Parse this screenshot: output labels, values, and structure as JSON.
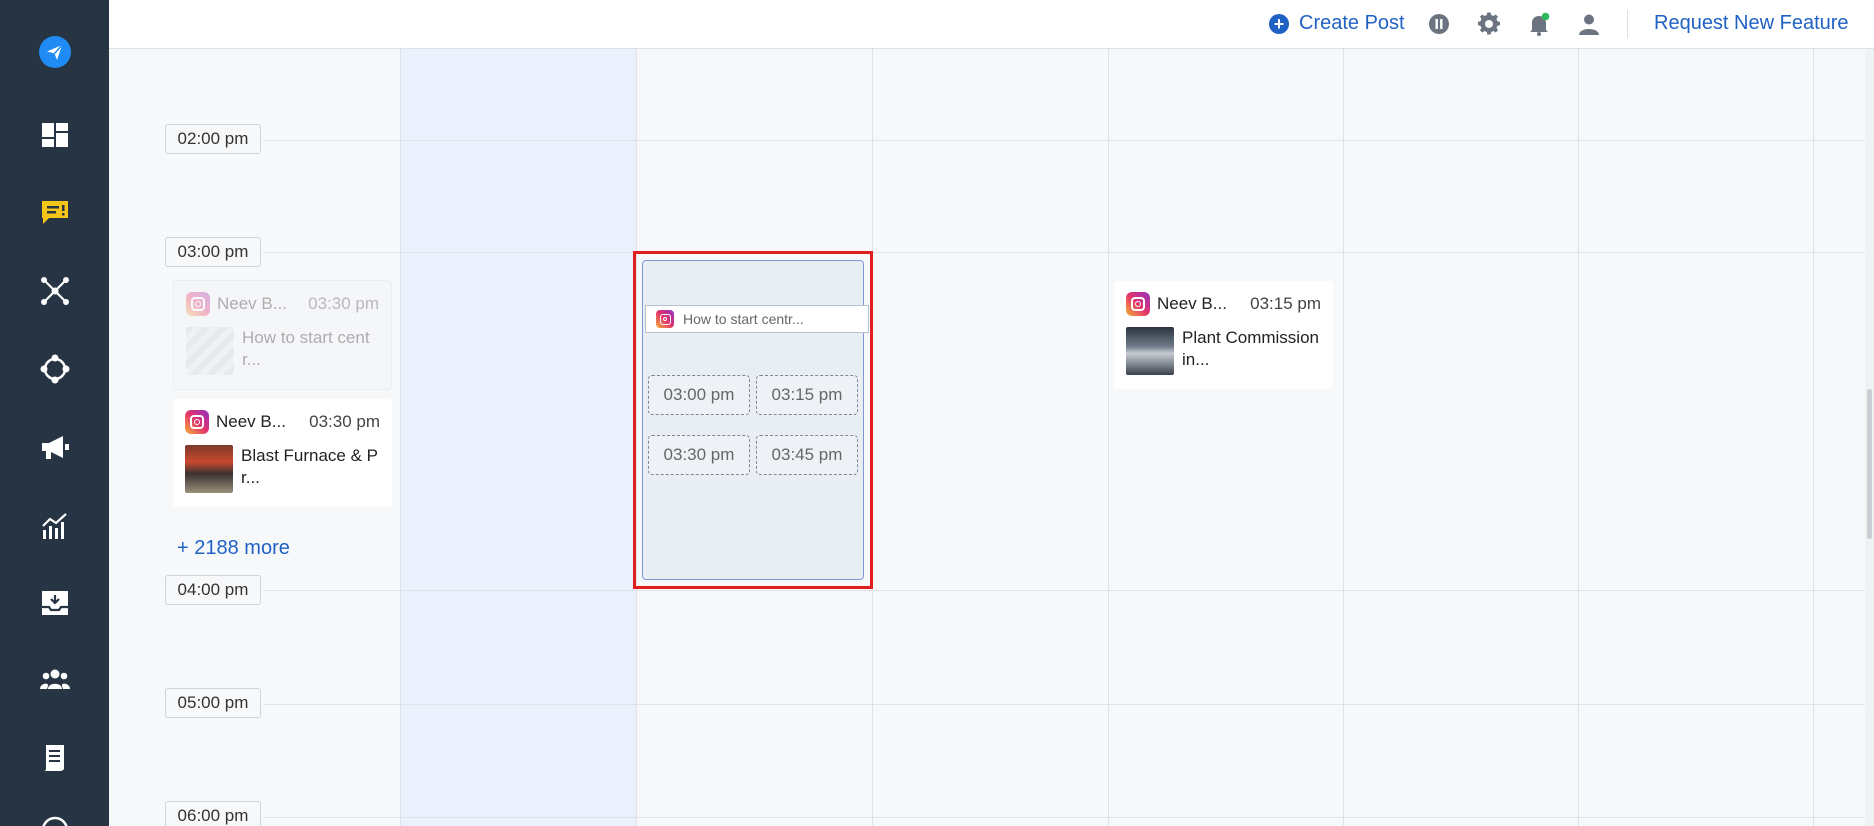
{
  "topbar": {
    "create_post_label": "Create Post",
    "request_feature_label": "Request New Feature"
  },
  "sidebar": {
    "icons": [
      "send-icon",
      "dashboard-icon",
      "chat-alert-icon",
      "network-icon",
      "hub-icon",
      "megaphone-icon",
      "analytics-icon",
      "inbox-download-icon",
      "team-icon",
      "document-icon",
      "help-icon"
    ]
  },
  "timeline": {
    "labels": [
      "02:00 pm",
      "03:00 pm",
      "04:00 pm",
      "05:00 pm",
      "06:00 pm"
    ]
  },
  "posts": {
    "faded": {
      "account": "Neev B...",
      "time": "03:30 pm",
      "caption_line1": "How to start cent",
      "caption_line2": "r..."
    },
    "blast": {
      "account": "Neev B...",
      "time": "03:30 pm",
      "caption_line1": "Blast Furnace & P",
      "caption_line2": "r..."
    },
    "plant": {
      "account": "Neev B...",
      "time": "03:15 pm",
      "caption_line1": "Plant Commission",
      "caption_line2": "in..."
    }
  },
  "more_label": "+ 2188 more",
  "drop_zone": {
    "preview_text": "How to start centr...",
    "slots": [
      "03:00 pm",
      "03:15 pm",
      "03:30 pm",
      "03:45 pm"
    ]
  },
  "colors": {
    "sidebar_bg": "#273444",
    "accent_blue": "#2062c4",
    "highlight_col": "#ebf1fc",
    "drop_border": "#e02020",
    "notification_dot": "#2eb85c",
    "chat_icon": "#f5c518"
  }
}
